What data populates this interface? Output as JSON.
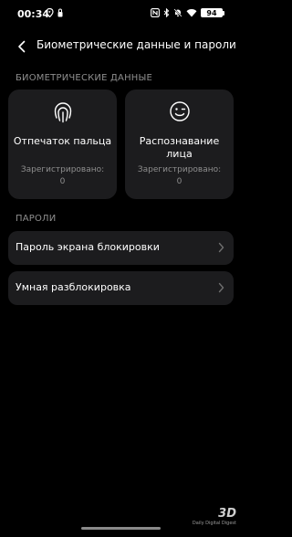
{
  "status_bar": {
    "time": "00:34",
    "left_icons": [
      "location-icon",
      "lock-icon"
    ],
    "right_icons": [
      "nfc-icon",
      "bluetooth-icon",
      "silent-icon",
      "wifi-icon"
    ],
    "battery": "94"
  },
  "header": {
    "title": "Биометрические данные и пароли"
  },
  "biometrics": {
    "section_title": "БИОМЕТРИЧЕСКИЕ ДАННЫЕ",
    "tiles": [
      {
        "icon": "fingerprint-icon",
        "title": "Отпечаток пальца",
        "status_label": "Зарегистрировано:",
        "status_value": "0"
      },
      {
        "icon": "face-icon",
        "title": "Распознавание лица",
        "status_label": "Зарегистрировано:",
        "status_value": "0"
      }
    ]
  },
  "passwords": {
    "section_title": "ПАРОЛИ",
    "items": [
      {
        "label": "Пароль экрана блокировки"
      },
      {
        "label": "Умная разблокировка"
      }
    ]
  },
  "watermark": {
    "mark": "3D",
    "sub": "Daily Digital Digest"
  },
  "colors": {
    "background": "#000000",
    "card": "#1c1c1e",
    "secondary_text": "#8e8e8e"
  }
}
